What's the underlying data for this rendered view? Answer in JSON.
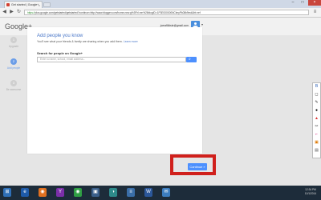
{
  "browser": {
    "tab_title": "Get started | Google+",
    "tab_close": "×",
    "url_scheme": "https://",
    "url_rest": "plus.google.com/getstarted/getstarted?continue=http://www.blogger.com/home-new.g%3Fhl=en%26blogID=1P3E000000NCbnyPk08b9md&frt=ref",
    "minimize": "–",
    "maximize": "□",
    "close": "×",
    "back": "◀",
    "forward": "▶",
    "reload": "↻",
    "menu": "≡"
  },
  "gplus": {
    "logo": "Google+",
    "email": "joerafilldsbr@gmail.com",
    "avatar_caret": "▾"
  },
  "steps": [
    {
      "number": "1",
      "label": "Upgrade"
    },
    {
      "number": "2",
      "label": "Add people"
    },
    {
      "number": "3",
      "label": "Be awesome"
    }
  ],
  "card": {
    "title": "Add people you know",
    "subtitle": "You'll see what your friends & family are sharing when you add them.",
    "learn_more": "Learn more",
    "search_label": "Search for people on Google+",
    "search_placeholder": "Enter a name, school, email address..."
  },
  "continue_label": "Continue »",
  "colors": {
    "accent": "#4d90fe",
    "title": "#4a77c8",
    "annotation": "#d0201c",
    "step_active": "#6a9de8",
    "step_inactive": "#cfcfcf"
  },
  "taskbar": {
    "start": "⊞",
    "apps": [
      "e",
      "◉",
      "Y",
      "◉",
      "▣",
      "◑",
      "≡",
      "W",
      "✉"
    ],
    "time": "12:34 PM",
    "date": "10/1/2014"
  },
  "tools": [
    "B",
    "◻",
    "✎",
    "●",
    "▲",
    "✂",
    "⌐",
    "▣",
    "▤"
  ]
}
